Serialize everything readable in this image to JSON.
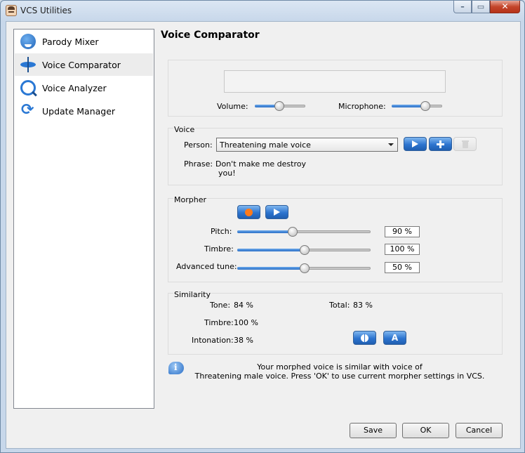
{
  "window": {
    "title": "VCS Utilities"
  },
  "sidebar": {
    "items": [
      {
        "label": "Parody Mixer",
        "icon": "parody-mixer-icon"
      },
      {
        "label": "Voice Comparator",
        "icon": "voice-comparator-icon",
        "active": true
      },
      {
        "label": "Voice Analyzer",
        "icon": "voice-analyzer-icon"
      },
      {
        "label": "Update Manager",
        "icon": "update-manager-icon"
      }
    ]
  },
  "page": {
    "title": "Voice Comparator"
  },
  "levels": {
    "volume_label": "Volume:",
    "volume_value": 0.47,
    "microphone_label": "Microphone:",
    "microphone_value": 0.65
  },
  "voice": {
    "group_label": "Voice",
    "person_label": "Person:",
    "person_selected": "Threatening male voice",
    "phrase_label": "Phrase:",
    "phrase_line1": "Don't make me destroy",
    "phrase_line2": "you!"
  },
  "morpher": {
    "group_label": "Morpher",
    "pitch_label": "Pitch:",
    "pitch_value": "90 %",
    "pitch_position": 0.41,
    "timbre_label": "Timbre:",
    "timbre_value": "100 %",
    "timbre_position": 0.5,
    "advanced_label": "Advanced tune:",
    "advanced_value": "50 %",
    "advanced_position": 0.5
  },
  "similarity": {
    "group_label": "Similarity",
    "tone_label": "Tone:",
    "tone_value": "84 %",
    "timbre_label": "Timbre:",
    "timbre_value": "100 %",
    "intonation_label": "Intonation:",
    "intonation_value": "38 %",
    "total_label": "Total:",
    "total_value": "83 %",
    "auto_button_label": "A"
  },
  "info": {
    "line1": "Your morphed voice is similar with voice of",
    "line2": "Threatening male voice. Press 'OK' to use current morpher settings in VCS."
  },
  "buttons": {
    "save": "Save",
    "ok": "OK",
    "cancel": "Cancel"
  },
  "colors": {
    "accent": "#2d74cf",
    "record": "#ff7a1a"
  }
}
